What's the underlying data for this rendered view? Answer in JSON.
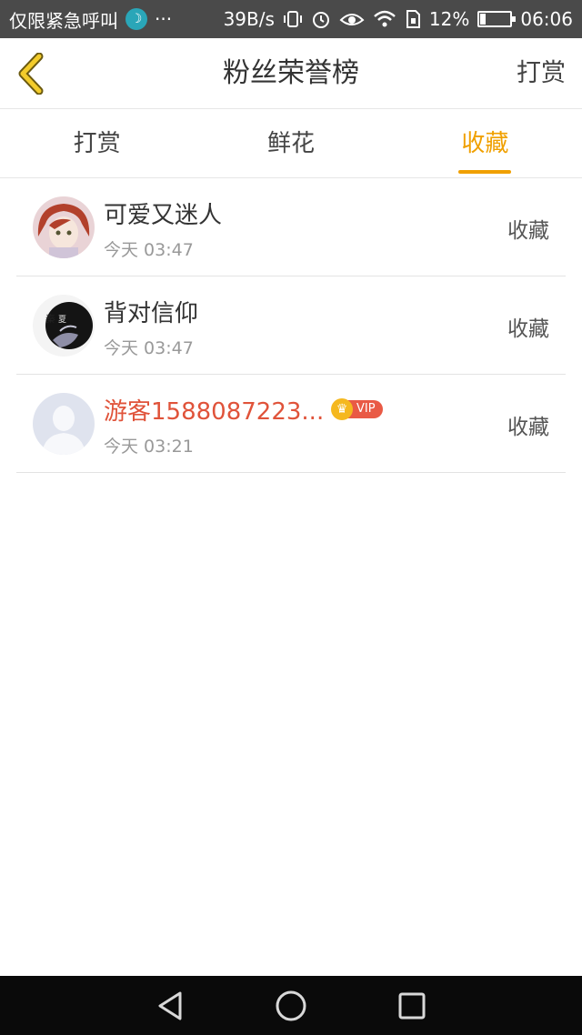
{
  "status_bar": {
    "carrier_text": "仅限紧急呼叫",
    "ellipsis": "···",
    "speed": "39B/s",
    "battery": "12%",
    "time": "06:06",
    "icons": [
      "moon-icon",
      "vibrate-icon",
      "alarm-icon",
      "eye-icon",
      "wifi-icon",
      "sim-icon",
      "battery-icon"
    ]
  },
  "header": {
    "title": "粉丝荣誉榜",
    "action_label": "打赏",
    "back_icon": "chevron-left-icon",
    "accent_color": "#f0a000"
  },
  "tabs": [
    {
      "label": "打赏",
      "active": false
    },
    {
      "label": "鲜花",
      "active": false
    },
    {
      "label": "收藏",
      "active": true
    }
  ],
  "list": {
    "items": [
      {
        "name": "可爱又迷人",
        "time": "今天 03:47",
        "action": "收藏",
        "vip": false
      },
      {
        "name": "背对信仰",
        "time": "今天 03:47",
        "action": "收藏",
        "vip": false
      },
      {
        "name": "游客1588087223...",
        "time": "今天 03:21",
        "action": "收藏",
        "vip": true,
        "vip_label": "VIP"
      }
    ]
  },
  "nav_bar": {
    "icons": [
      "back-triangle-icon",
      "home-circle-icon",
      "recents-square-icon"
    ]
  }
}
